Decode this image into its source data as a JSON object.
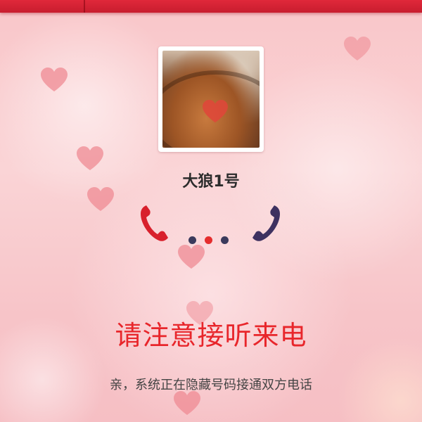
{
  "caller": {
    "name": "大狼1号"
  },
  "status": {
    "headline": "请注意接听来电",
    "subtext": "亲，系统正在隐藏号码接通双方电话"
  },
  "colors": {
    "top_bar": "#d42234",
    "headline": "#e8262b",
    "phone_left": "#d8202c",
    "phone_right": "#3e3160",
    "dot_dark": "#3b3a5c",
    "dot_red": "#e52d2d"
  },
  "icons": {
    "left_phone": "phone-icon",
    "right_phone": "phone-icon",
    "connecting_dots": "ellipsis-icon",
    "hearts": "heart-icon"
  }
}
